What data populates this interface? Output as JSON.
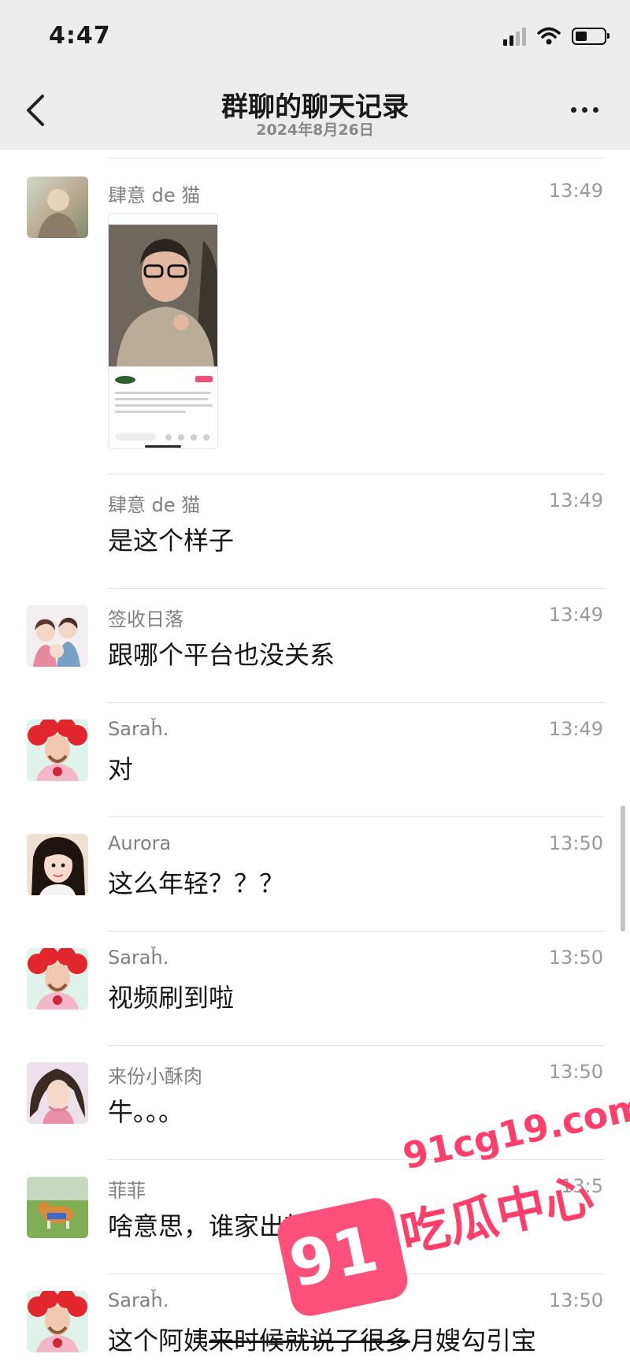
{
  "status_bar": {
    "time": "4:47"
  },
  "header": {
    "title": "群聊的聊天记录",
    "subtitle": "2024年8月26日"
  },
  "messages": [
    {
      "sender": "肆意 de 猫",
      "time": "13:49",
      "type": "image"
    },
    {
      "sender": "肆意 de 猫",
      "time": "13:49",
      "text": "是这个样子"
    },
    {
      "sender": "签收日落",
      "time": "13:49",
      "text": "跟哪个平台也没关系"
    },
    {
      "sender": "Saraȟ.",
      "time": "13:49",
      "text": "对"
    },
    {
      "sender": "Aurora",
      "time": "13:50",
      "text": "这么年轻？？？"
    },
    {
      "sender": "Saraȟ.",
      "time": "13:50",
      "text": "视频刷到啦"
    },
    {
      "sender": "来份小酥肉",
      "time": "13:50",
      "text": "牛。。。"
    },
    {
      "sender": "菲菲",
      "time": "13:5",
      "text": "啥意思，谁家出轨月嫂了"
    },
    {
      "sender": "Saraȟ.",
      "time": "13:50",
      "text_a": "这个阿姨",
      "text_b": "来时候就说了很多",
      "text_c": "月嫂勾引宝"
    }
  ],
  "watermark": {
    "url": "91cg19.com",
    "badge": "91",
    "brand": "吃瓜中心"
  },
  "colors": {
    "header_bg": "#ededed",
    "watermark": "#ff3e6b"
  }
}
